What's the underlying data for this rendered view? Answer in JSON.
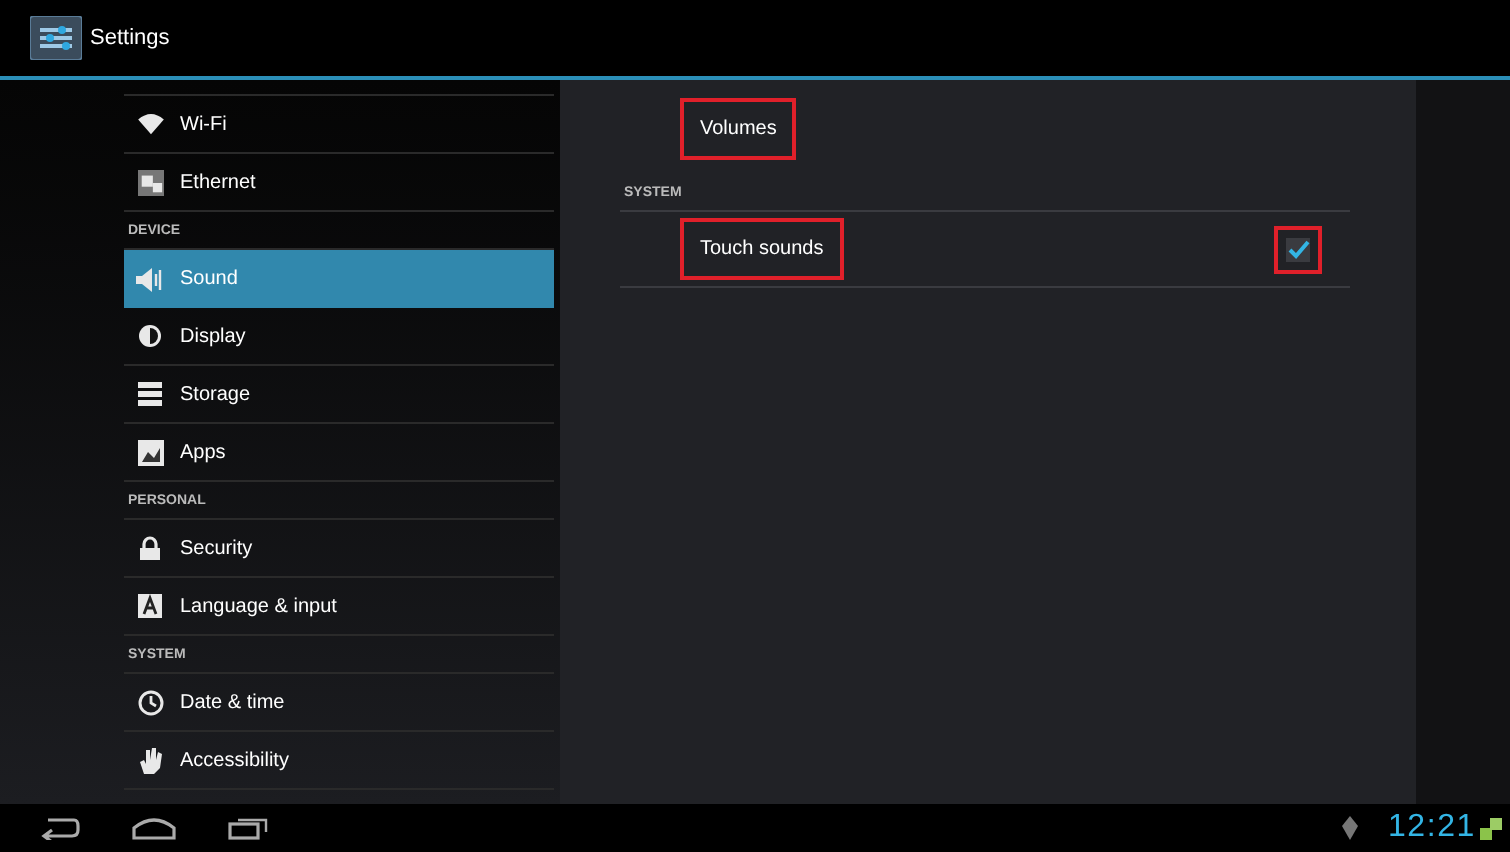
{
  "action_bar": {
    "title": "Settings"
  },
  "sidebar": [
    {
      "kind": "item",
      "label": "Wi-Fi",
      "selected": false
    },
    {
      "kind": "item",
      "label": "Ethernet",
      "selected": false
    },
    {
      "kind": "header",
      "label": "DEVICE"
    },
    {
      "kind": "item",
      "label": "Sound",
      "selected": true
    },
    {
      "kind": "item",
      "label": "Display",
      "selected": false
    },
    {
      "kind": "item",
      "label": "Storage",
      "selected": false
    },
    {
      "kind": "item",
      "label": "Apps",
      "selected": false
    },
    {
      "kind": "header",
      "label": "PERSONAL"
    },
    {
      "kind": "item",
      "label": "Security",
      "selected": false
    },
    {
      "kind": "item",
      "label": "Language & input",
      "selected": false
    },
    {
      "kind": "header",
      "label": "SYSTEM"
    },
    {
      "kind": "item",
      "label": "Date & time",
      "selected": false
    },
    {
      "kind": "item",
      "label": "Accessibility",
      "selected": false
    }
  ],
  "content": [
    {
      "kind": "item",
      "label": "Volumes",
      "outlined": true
    },
    {
      "kind": "header",
      "label": "SYSTEM"
    },
    {
      "kind": "check",
      "label": "Touch sounds",
      "outlined": true,
      "checked": true,
      "checkbox_outlined": true
    }
  ],
  "status_bar": {
    "time": "12:21"
  }
}
